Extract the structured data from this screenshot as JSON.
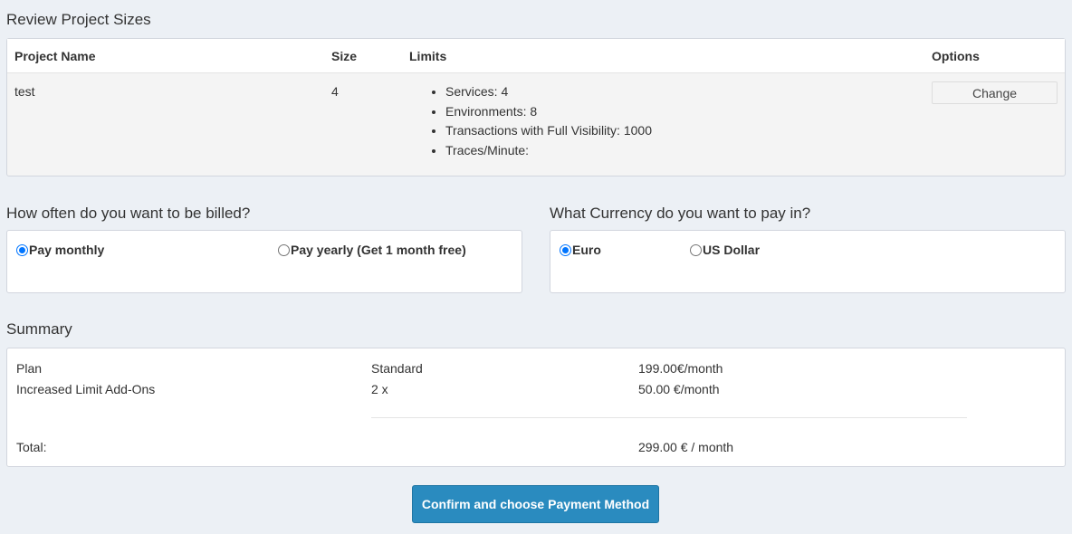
{
  "review": {
    "title": "Review Project Sizes",
    "columns": {
      "name": "Project Name",
      "size": "Size",
      "limits": "Limits",
      "options": "Options"
    },
    "project": {
      "name": "test",
      "size": "4",
      "limits": [
        "Services: 4",
        "Environments: 8",
        "Transactions with Full Visibility: 1000",
        "Traces/Minute:"
      ],
      "change_label": "Change"
    }
  },
  "billing": {
    "title": "How often do you want to be billed?",
    "options": [
      {
        "label": "Pay monthly",
        "checked": true
      },
      {
        "label": "Pay yearly (Get 1 month free)",
        "checked": false
      }
    ]
  },
  "currency": {
    "title": "What Currency do you want to pay in?",
    "options": [
      {
        "label": "Euro",
        "checked": true
      },
      {
        "label": "US Dollar",
        "checked": false
      }
    ]
  },
  "summary": {
    "title": "Summary",
    "plan_label": "Plan",
    "plan_name": "Standard",
    "plan_price": "199.00€/month",
    "addons_label": "Increased Limit Add-Ons",
    "addons_qty": "2 x",
    "addons_price": "50.00 €/month",
    "total_label": "Total:",
    "total_value": "299.00 € / month"
  },
  "confirm_label": "Confirm and choose Payment Method",
  "colors": {
    "accent": "#2a8bbf",
    "radio_checked": "#0075ff",
    "background": "#ecf0f5"
  }
}
